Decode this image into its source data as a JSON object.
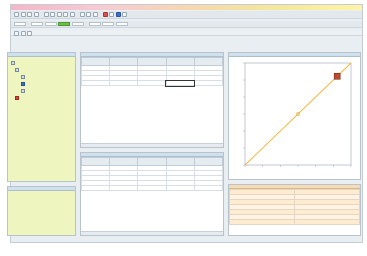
{
  "colors": {
    "accent": "#d9534f",
    "chart_line": "#f2b233",
    "tree_bg": "#eef5bf",
    "props_bg": "#fdeccf"
  },
  "toolbar_icons": [
    "new-icon",
    "open-icon",
    "save-icon",
    "print-icon",
    "cut-icon",
    "copy-icon",
    "paste-icon",
    "undo-icon",
    "redo-icon",
    "find-icon",
    "zoom-icon",
    "settings-icon",
    "run-icon",
    "stop-icon",
    "chart-icon",
    "help-icon"
  ],
  "panels": {
    "tree": "",
    "grid1": "",
    "grid2": "",
    "chart": "",
    "props": "",
    "bottomleft": ""
  },
  "tree_items": [
    {
      "label": ""
    },
    {
      "label": ""
    },
    {
      "label": ""
    },
    {
      "label": ""
    },
    {
      "label": ""
    },
    {
      "label": ""
    }
  ],
  "grid1": {
    "headers": [
      "",
      "",
      "",
      "",
      ""
    ],
    "rows": [
      [
        "",
        "",
        "",
        "",
        ""
      ],
      [
        "",
        "",
        "",
        "",
        ""
      ],
      [
        "",
        "",
        "",
        "",
        ""
      ],
      [
        "",
        "",
        "",
        "",
        ""
      ]
    ]
  },
  "grid2": {
    "headers": [
      "",
      "",
      "",
      "",
      ""
    ],
    "rows": [
      [
        "",
        "",
        "",
        "",
        ""
      ],
      [
        "",
        "",
        "",
        "",
        ""
      ],
      [
        "",
        "",
        "",
        "",
        ""
      ],
      [
        "",
        "",
        "",
        "",
        ""
      ],
      [
        "",
        "",
        "",
        "",
        ""
      ]
    ]
  },
  "props": {
    "rows": [
      [
        "",
        ""
      ],
      [
        "",
        ""
      ],
      [
        "",
        ""
      ],
      [
        "",
        ""
      ],
      [
        "",
        ""
      ],
      [
        "",
        ""
      ],
      [
        "",
        ""
      ]
    ]
  },
  "chart_data": {
    "type": "line",
    "title": "",
    "xlabel": "",
    "ylabel": "",
    "x": [
      0,
      1
    ],
    "series": [
      {
        "values": [
          0,
          1
        ]
      }
    ],
    "markers": [
      {
        "x": 0.5,
        "y": 0.5
      },
      {
        "x": 0.87,
        "y": 0.87
      }
    ],
    "xlim": [
      0,
      1
    ],
    "ylim": [
      0,
      1
    ],
    "grid": false
  }
}
